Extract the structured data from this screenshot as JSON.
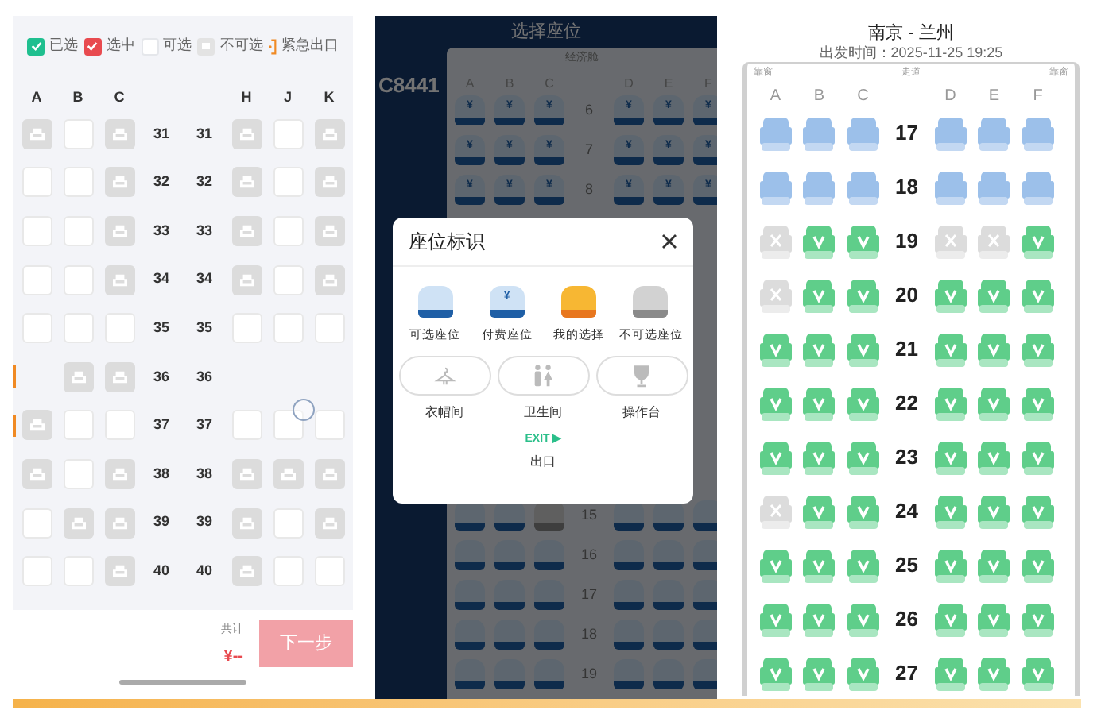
{
  "seat_selection": {
    "legend": [
      {
        "kind": "booked",
        "label": "已选"
      },
      {
        "kind": "selected",
        "label": "选中"
      },
      {
        "kind": "available",
        "label": "可选"
      },
      {
        "kind": "unavailable",
        "label": "不可选"
      },
      {
        "kind": "exit",
        "label": "紧急出口"
      }
    ],
    "columns_left": [
      "A",
      "B",
      "C"
    ],
    "columns_right": [
      "H",
      "J",
      "K"
    ],
    "rows": [
      {
        "numbers": [
          "31",
          "31"
        ],
        "exit": false,
        "left": [
          {
            "kind": "occupied"
          },
          {
            "kind": "available"
          },
          {
            "kind": "occupied"
          }
        ],
        "right": [
          {
            "kind": "occupied"
          },
          {
            "kind": "available"
          },
          {
            "kind": "occupied"
          }
        ]
      },
      {
        "numbers": [
          "32",
          "32"
        ],
        "exit": false,
        "left": [
          {
            "kind": "available"
          },
          {
            "kind": "available"
          },
          {
            "kind": "occupied"
          }
        ],
        "right": [
          {
            "kind": "occupied"
          },
          {
            "kind": "available"
          },
          {
            "kind": "occupied"
          }
        ]
      },
      {
        "numbers": [
          "33",
          "33"
        ],
        "exit": false,
        "left": [
          {
            "kind": "available"
          },
          {
            "kind": "available"
          },
          {
            "kind": "occupied"
          }
        ],
        "right": [
          {
            "kind": "occupied"
          },
          {
            "kind": "available"
          },
          {
            "kind": "occupied"
          }
        ]
      },
      {
        "numbers": [
          "34",
          "34"
        ],
        "exit": false,
        "left": [
          {
            "kind": "available"
          },
          {
            "kind": "available"
          },
          {
            "kind": "occupied"
          }
        ],
        "right": [
          {
            "kind": "occupied"
          },
          {
            "kind": "available"
          },
          {
            "kind": "occupied"
          }
        ]
      },
      {
        "numbers": [
          "35",
          "35"
        ],
        "exit": false,
        "left": [
          {
            "kind": "available"
          },
          {
            "kind": "available"
          },
          {
            "kind": "available"
          }
        ],
        "right": [
          {
            "kind": "available"
          },
          {
            "kind": "available"
          },
          {
            "kind": "available"
          }
        ]
      },
      {
        "numbers": [
          "36",
          "36"
        ],
        "exit": true,
        "left": [
          {
            "kind": "none"
          },
          {
            "kind": "occupied"
          },
          {
            "kind": "occupied"
          }
        ],
        "right": [
          {
            "kind": "none"
          },
          {
            "kind": "none"
          },
          {
            "kind": "none"
          }
        ]
      },
      {
        "numbers": [
          "37",
          "37"
        ],
        "exit": true,
        "left": [
          {
            "kind": "occupied"
          },
          {
            "kind": "available"
          },
          {
            "kind": "available"
          }
        ],
        "right": [
          {
            "kind": "available"
          },
          {
            "kind": "available"
          },
          {
            "kind": "available"
          }
        ]
      },
      {
        "numbers": [
          "38",
          "38"
        ],
        "exit": false,
        "left": [
          {
            "kind": "occupied"
          },
          {
            "kind": "available"
          },
          {
            "kind": "occupied"
          }
        ],
        "right": [
          {
            "kind": "occupied"
          },
          {
            "kind": "occupied"
          },
          {
            "kind": "occupied"
          }
        ]
      },
      {
        "numbers": [
          "39",
          "39"
        ],
        "exit": false,
        "left": [
          {
            "kind": "available"
          },
          {
            "kind": "occupied"
          },
          {
            "kind": "occupied"
          }
        ],
        "right": [
          {
            "kind": "occupied"
          },
          {
            "kind": "available"
          },
          {
            "kind": "occupied"
          }
        ]
      },
      {
        "numbers": [
          "40",
          "40"
        ],
        "exit": false,
        "left": [
          {
            "kind": "available"
          },
          {
            "kind": "available"
          },
          {
            "kind": "occupied"
          }
        ],
        "right": [
          {
            "kind": "occupied"
          },
          {
            "kind": "available"
          },
          {
            "kind": "available"
          }
        ]
      }
    ],
    "total_label": "共计",
    "price": "¥--",
    "next_button": {
      "label": "下一步",
      "disabled": true
    }
  },
  "cabin_map": {
    "title": "选择座位",
    "flight": "C8441",
    "cabin": "经济舱",
    "columns": [
      "A",
      "B",
      "C",
      "D",
      "E",
      "F"
    ],
    "rows_top": [
      {
        "number": "6",
        "seats": [
          {
            "kind": "paid",
            "label": "¥"
          },
          {
            "kind": "paid",
            "label": "¥"
          },
          {
            "kind": "paid",
            "label": "¥"
          },
          {
            "kind": "paid",
            "label": "¥"
          },
          {
            "kind": "paid",
            "label": "¥"
          },
          {
            "kind": "paid",
            "label": "¥"
          }
        ]
      },
      {
        "number": "7",
        "seats": [
          {
            "kind": "paid",
            "label": "¥"
          },
          {
            "kind": "paid",
            "label": "¥"
          },
          {
            "kind": "paid",
            "label": "¥"
          },
          {
            "kind": "paid",
            "label": "¥"
          },
          {
            "kind": "paid",
            "label": "¥"
          },
          {
            "kind": "paid",
            "label": "¥"
          }
        ]
      },
      {
        "number": "8",
        "seats": [
          {
            "kind": "paid",
            "label": "¥"
          },
          {
            "kind": "paid",
            "label": "¥"
          },
          {
            "kind": "paid",
            "label": "¥"
          },
          {
            "kind": "paid",
            "label": "¥"
          },
          {
            "kind": "paid",
            "label": "¥"
          },
          {
            "kind": "paid",
            "label": "¥"
          }
        ]
      }
    ],
    "rows_bottom": [
      {
        "number": "15",
        "seats": [
          {
            "kind": "free"
          },
          {
            "kind": "free"
          },
          {
            "kind": "unavailable"
          },
          {
            "kind": "free"
          },
          {
            "kind": "free"
          },
          {
            "kind": "free"
          }
        ]
      },
      {
        "number": "16",
        "seats": [
          {
            "kind": "free"
          },
          {
            "kind": "free"
          },
          {
            "kind": "free"
          },
          {
            "kind": "free"
          },
          {
            "kind": "free"
          },
          {
            "kind": "free"
          }
        ]
      },
      {
        "number": "17",
        "seats": [
          {
            "kind": "free"
          },
          {
            "kind": "free"
          },
          {
            "kind": "free"
          },
          {
            "kind": "free"
          },
          {
            "kind": "free"
          },
          {
            "kind": "free"
          }
        ]
      },
      {
        "number": "18",
        "seats": [
          {
            "kind": "free"
          },
          {
            "kind": "free"
          },
          {
            "kind": "free"
          },
          {
            "kind": "free"
          },
          {
            "kind": "free"
          },
          {
            "kind": "free"
          }
        ]
      },
      {
        "number": "19",
        "seats": [
          {
            "kind": "free"
          },
          {
            "kind": "free"
          },
          {
            "kind": "free"
          },
          {
            "kind": "free"
          },
          {
            "kind": "free"
          },
          {
            "kind": "free"
          }
        ]
      }
    ]
  },
  "legend_dialog": {
    "title": "座位标识",
    "items": [
      {
        "kind": "free",
        "label": "可选座位"
      },
      {
        "kind": "paid",
        "mark": "¥",
        "label": "付费座位"
      },
      {
        "kind": "mine",
        "label": "我的选择"
      },
      {
        "kind": "unavailable",
        "label": "不可选座位"
      }
    ],
    "facilities": [
      {
        "kind": "cloakroom",
        "label": "衣帽间"
      },
      {
        "kind": "lavatory",
        "label": "卫生间"
      },
      {
        "kind": "galley",
        "label": "操作台"
      }
    ],
    "exit_sign": "EXIT ▶",
    "exit_label": "出口"
  },
  "train_seats": {
    "route": "南京 - 兰州",
    "departure": "出发时间：2025-11-25 19:25",
    "side_labels": [
      "靠窗",
      "走道",
      "靠窗"
    ],
    "columns": [
      "A",
      "B",
      "C",
      "D",
      "E",
      "F"
    ],
    "rows": [
      {
        "number": "17",
        "seats": [
          {
            "kind": "locked"
          },
          {
            "kind": "locked"
          },
          {
            "kind": "locked"
          },
          {
            "kind": "locked"
          },
          {
            "kind": "locked"
          },
          {
            "kind": "locked"
          }
        ]
      },
      {
        "number": "18",
        "seats": [
          {
            "kind": "locked"
          },
          {
            "kind": "locked"
          },
          {
            "kind": "locked"
          },
          {
            "kind": "locked"
          },
          {
            "kind": "locked"
          },
          {
            "kind": "locked"
          }
        ]
      },
      {
        "number": "19",
        "seats": [
          {
            "kind": "sold"
          },
          {
            "kind": "available"
          },
          {
            "kind": "available"
          },
          {
            "kind": "sold"
          },
          {
            "kind": "sold"
          },
          {
            "kind": "available"
          }
        ]
      },
      {
        "number": "20",
        "seats": [
          {
            "kind": "sold"
          },
          {
            "kind": "available"
          },
          {
            "kind": "available"
          },
          {
            "kind": "available"
          },
          {
            "kind": "available"
          },
          {
            "kind": "available"
          }
        ]
      },
      {
        "number": "21",
        "seats": [
          {
            "kind": "available"
          },
          {
            "kind": "available"
          },
          {
            "kind": "available"
          },
          {
            "kind": "available"
          },
          {
            "kind": "available"
          },
          {
            "kind": "available"
          }
        ]
      },
      {
        "number": "22",
        "seats": [
          {
            "kind": "available"
          },
          {
            "kind": "available"
          },
          {
            "kind": "available"
          },
          {
            "kind": "available"
          },
          {
            "kind": "available"
          },
          {
            "kind": "available"
          }
        ]
      },
      {
        "number": "23",
        "seats": [
          {
            "kind": "available"
          },
          {
            "kind": "available"
          },
          {
            "kind": "available"
          },
          {
            "kind": "available"
          },
          {
            "kind": "available"
          },
          {
            "kind": "available"
          }
        ]
      },
      {
        "number": "24",
        "seats": [
          {
            "kind": "sold"
          },
          {
            "kind": "available"
          },
          {
            "kind": "available"
          },
          {
            "kind": "available"
          },
          {
            "kind": "available"
          },
          {
            "kind": "available"
          }
        ]
      },
      {
        "number": "25",
        "seats": [
          {
            "kind": "available"
          },
          {
            "kind": "available"
          },
          {
            "kind": "available"
          },
          {
            "kind": "available"
          },
          {
            "kind": "available"
          },
          {
            "kind": "available"
          }
        ]
      },
      {
        "number": "26",
        "seats": [
          {
            "kind": "available"
          },
          {
            "kind": "available"
          },
          {
            "kind": "available"
          },
          {
            "kind": "available"
          },
          {
            "kind": "available"
          },
          {
            "kind": "available"
          }
        ]
      },
      {
        "number": "27",
        "seats": [
          {
            "kind": "available"
          },
          {
            "kind": "available"
          },
          {
            "kind": "available"
          },
          {
            "kind": "available"
          },
          {
            "kind": "available"
          },
          {
            "kind": "available"
          }
        ]
      }
    ]
  }
}
